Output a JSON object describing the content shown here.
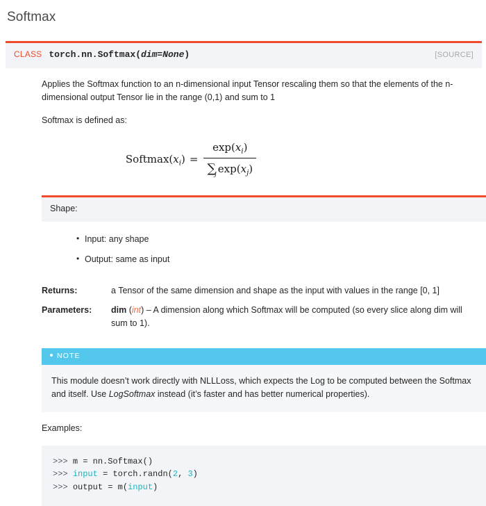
{
  "page": {
    "title": "Softmax"
  },
  "signature": {
    "class_tag": "CLASS",
    "qualname": "torch.nn.Softmax",
    "open_paren": "(",
    "param": "dim=None",
    "close_paren": ")",
    "source_link": "[SOURCE]",
    "accent_color": "#ee4c2c",
    "tag_color": "#ee4c2c",
    "bar_bg": "#f3f4f7",
    "source_color": "#a7a7a7"
  },
  "description": {
    "paragraph1": "Applies the Softmax function to an n-dimensional input Tensor rescaling them so that the elements of the n-dimensional output Tensor lie in the range (0,1) and sum to 1",
    "paragraph2": "Softmax is defined as:"
  },
  "formula": {
    "lhs_name": "Softmax",
    "lhs_open": "(",
    "lhs_var": "x",
    "lhs_sub": "i",
    "lhs_close": ")",
    "equals": "=",
    "num_fn": "exp",
    "num_open": "(",
    "num_var": "x",
    "num_sub": "i",
    "num_close": ")",
    "den_sum": "∑",
    "den_sum_sub": "j",
    "den_fn": "exp",
    "den_open": "(",
    "den_var": "x",
    "den_sub": "j",
    "den_close": ")",
    "latex": "Softmax(x_i) = exp(x_i) / sum_j exp(x_j)"
  },
  "shape": {
    "heading": "Shape:",
    "items": [
      "Input: any shape",
      "Output: same as input"
    ],
    "band_bg": "#f3f4f7",
    "band_border": "#ee4c2c"
  },
  "fields": {
    "returns": {
      "label": "Returns:",
      "text": "a Tensor of the same dimension and shape as the input with values in the range [0, 1]"
    },
    "parameters": {
      "label": "Parameters:",
      "name": "dim",
      "type_open": "(",
      "type": "int",
      "type_close": ")",
      "separator": " – ",
      "text": "A dimension along which Softmax will be computed (so every slice along dim will sum to 1).",
      "type_color": "#ee6a44"
    }
  },
  "note": {
    "header": "NOTE",
    "header_bg": "#54c7ec",
    "body_before": "This module doesn’t work directly with NLLLoss, which expects the Log to be computed between the Softmax and itself. Use ",
    "body_emphasis": "LogSoftmax",
    "body_after": " instead (it’s faster and has better numerical properties)."
  },
  "examples": {
    "label": "Examples:",
    "code_bg": "#f3f4f7",
    "lines": [
      {
        "prompt": ">>> ",
        "segments": [
          {
            "text": "m = nn.Softmax()",
            "kind": "plain"
          }
        ]
      },
      {
        "prompt": ">>> ",
        "segments": [
          {
            "text": "input",
            "kind": "builtin"
          },
          {
            "text": " = torch.randn(",
            "kind": "plain"
          },
          {
            "text": "2",
            "kind": "num"
          },
          {
            "text": ", ",
            "kind": "plain"
          },
          {
            "text": "3",
            "kind": "num"
          },
          {
            "text": ")",
            "kind": "plain"
          }
        ]
      },
      {
        "prompt": ">>> ",
        "segments": [
          {
            "text": "output = m(",
            "kind": "plain"
          },
          {
            "text": "input",
            "kind": "builtin"
          },
          {
            "text": ")",
            "kind": "plain"
          }
        ]
      }
    ]
  }
}
